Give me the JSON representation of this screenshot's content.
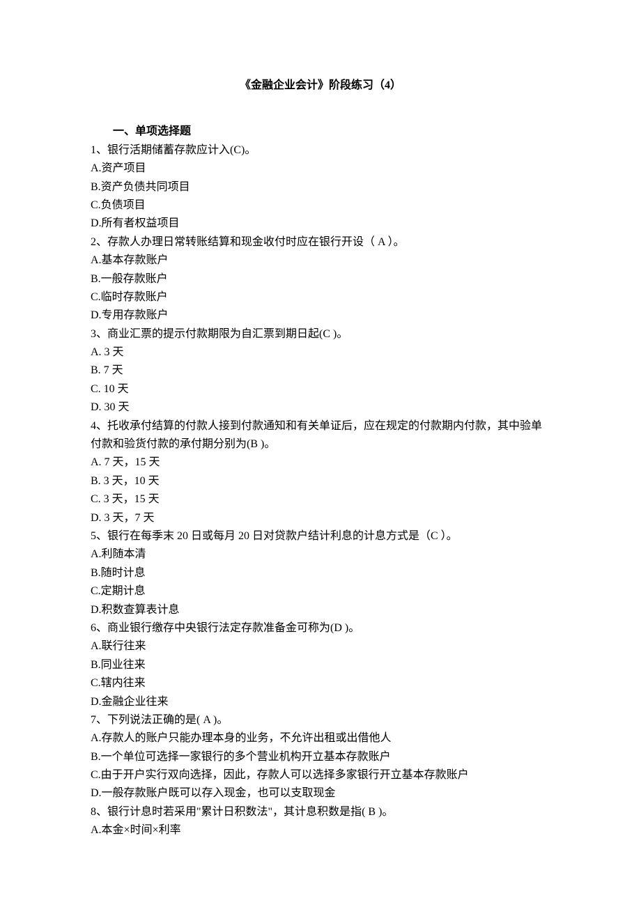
{
  "title": "《金融企业会计》阶段练习（4）",
  "section_heading": "一、单项选择题",
  "lines": [
    "1、银行活期储蓄存款应计入(C)。",
    "A.资产项目",
    "B.资产负债共同项目",
    "C.负债项目",
    "D.所有者权益项目",
    "2、存款人办理日常转账结算和现金收付时应在银行开设（ A ）。",
    "A.基本存款账户",
    "B.一般存款账户",
    "C.临时存款账户",
    "D.专用存款账户",
    "3、商业汇票的提示付款期限为自汇票到期日起(C )。",
    "A.  3 天",
    "B. 7 天",
    "C. 10 天",
    "D. 30 天",
    "4、托收承付结算的付款人接到付款通知和有关单证后，应在规定的付款期内付款，其中验单付款和验货付款的承付期分别为(B )。",
    "A.  7 天，15 天",
    "B. 3 天，10 天",
    "C. 3 天，15 天",
    "D. 3 天，7 天",
    "5、银行在每季末 20 日或每月 20 日对贷款户结计利息的计息方式是（C  ）。",
    "A.利随本清",
    "B.随时计息",
    "C.定期计息",
    "D.积数查算表计息",
    "6、商业银行缴存中央银行法定存款准备金可称为(D )。",
    "A.联行往来",
    "B.同业往来",
    "C.辖内往来",
    "D.金融企业往来",
    "7、下列说法正确的是( A )。",
    "A.存款人的账户只能办理本身的业务，不允许出租或出借他人",
    "B.一个单位可选择一家银行的多个营业机构开立基本存款账户",
    "C.由于开户实行双向选择，因此，存款人可以选择多家银行开立基本存款账户",
    "D.一般存款账户既可以存入现金，也可以支取现金",
    "8、银行计息时若采用\"累计日积数法\"，其计息积数是指( B )。",
    "A.本金×时间×利率"
  ]
}
